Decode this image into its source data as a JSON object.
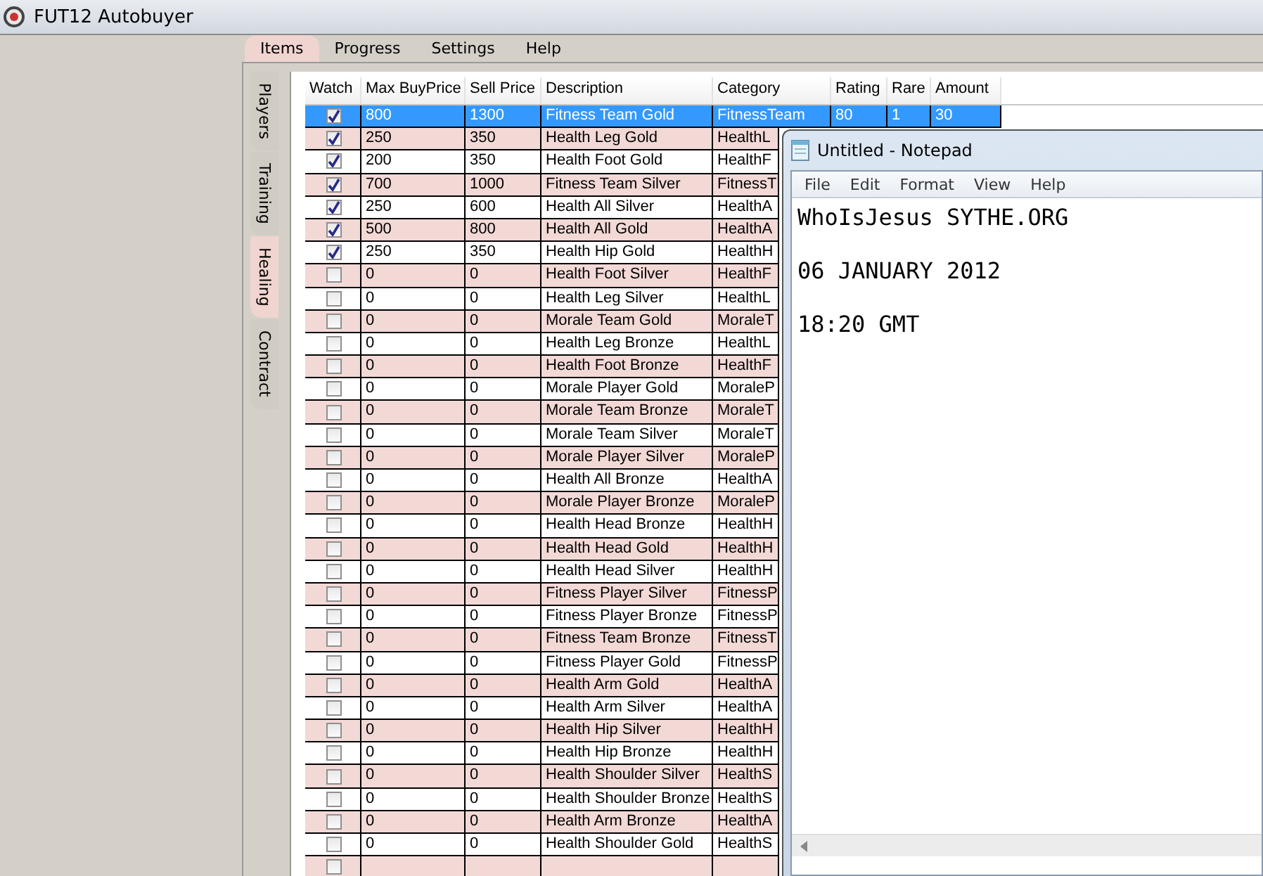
{
  "window": {
    "title": "FUT12 Autobuyer"
  },
  "menu_tabs": [
    {
      "label": "Items",
      "selected": true
    },
    {
      "label": "Progress",
      "selected": false
    },
    {
      "label": "Settings",
      "selected": false
    },
    {
      "label": "Help",
      "selected": false
    }
  ],
  "side_tabs": [
    {
      "label": "Players",
      "selected": false
    },
    {
      "label": "Training",
      "selected": false
    },
    {
      "label": "Healing",
      "selected": true
    },
    {
      "label": "Contract",
      "selected": false
    }
  ],
  "table": {
    "columns": [
      "Watch",
      "Max BuyPrice",
      "Sell Price",
      "Description",
      "Category",
      "Rating",
      "Rare",
      "Amount"
    ],
    "rows": [
      {
        "selected": true,
        "watch": true,
        "max_buy_price": "800",
        "sell_price": "1300",
        "description": "Fitness Team Gold",
        "category": "FitnessTeam",
        "rating": "80",
        "rare": "1",
        "amount": "30"
      },
      {
        "selected": false,
        "watch": true,
        "max_buy_price": "250",
        "sell_price": "350",
        "description": "Health Leg Gold",
        "category": "HealthL"
      },
      {
        "selected": false,
        "watch": true,
        "max_buy_price": "200",
        "sell_price": "350",
        "description": "Health Foot Gold",
        "category": "HealthF"
      },
      {
        "selected": false,
        "watch": true,
        "max_buy_price": "700",
        "sell_price": "1000",
        "description": "Fitness Team Silver",
        "category": "FitnessT"
      },
      {
        "selected": false,
        "watch": true,
        "max_buy_price": "250",
        "sell_price": "600",
        "description": "Health All Silver",
        "category": "HealthA"
      },
      {
        "selected": false,
        "watch": true,
        "max_buy_price": "500",
        "sell_price": "800",
        "description": "Health All Gold",
        "category": "HealthA"
      },
      {
        "selected": false,
        "watch": true,
        "max_buy_price": "250",
        "sell_price": "350",
        "description": "Health Hip Gold",
        "category": "HealthH"
      },
      {
        "selected": false,
        "watch": false,
        "max_buy_price": "0",
        "sell_price": "0",
        "description": "Health Foot Silver",
        "category": "HealthF"
      },
      {
        "selected": false,
        "watch": false,
        "max_buy_price": "0",
        "sell_price": "0",
        "description": "Health Leg Silver",
        "category": "HealthL"
      },
      {
        "selected": false,
        "watch": false,
        "max_buy_price": "0",
        "sell_price": "0",
        "description": "Morale Team Gold",
        "category": "MoraleT"
      },
      {
        "selected": false,
        "watch": false,
        "max_buy_price": "0",
        "sell_price": "0",
        "description": "Health Leg Bronze",
        "category": "HealthL"
      },
      {
        "selected": false,
        "watch": false,
        "max_buy_price": "0",
        "sell_price": "0",
        "description": "Health Foot Bronze",
        "category": "HealthF"
      },
      {
        "selected": false,
        "watch": false,
        "max_buy_price": "0",
        "sell_price": "0",
        "description": "Morale Player Gold",
        "category": "MoraleP"
      },
      {
        "selected": false,
        "watch": false,
        "max_buy_price": "0",
        "sell_price": "0",
        "description": "Morale Team Bronze",
        "category": "MoraleT"
      },
      {
        "selected": false,
        "watch": false,
        "max_buy_price": "0",
        "sell_price": "0",
        "description": "Morale Team Silver",
        "category": "MoraleT"
      },
      {
        "selected": false,
        "watch": false,
        "max_buy_price": "0",
        "sell_price": "0",
        "description": "Morale Player Silver",
        "category": "MoraleP"
      },
      {
        "selected": false,
        "watch": false,
        "max_buy_price": "0",
        "sell_price": "0",
        "description": "Health All Bronze",
        "category": "HealthA"
      },
      {
        "selected": false,
        "watch": false,
        "max_buy_price": "0",
        "sell_price": "0",
        "description": "Morale Player Bronze",
        "category": "MoraleP"
      },
      {
        "selected": false,
        "watch": false,
        "max_buy_price": "0",
        "sell_price": "0",
        "description": "Health Head Bronze",
        "category": "HealthH"
      },
      {
        "selected": false,
        "watch": false,
        "max_buy_price": "0",
        "sell_price": "0",
        "description": "Health Head Gold",
        "category": "HealthH"
      },
      {
        "selected": false,
        "watch": false,
        "max_buy_price": "0",
        "sell_price": "0",
        "description": "Health Head Silver",
        "category": "HealthH"
      },
      {
        "selected": false,
        "watch": false,
        "max_buy_price": "0",
        "sell_price": "0",
        "description": "Fitness Player Silver",
        "category": "FitnessP"
      },
      {
        "selected": false,
        "watch": false,
        "max_buy_price": "0",
        "sell_price": "0",
        "description": "Fitness Player Bronze",
        "category": "FitnessP"
      },
      {
        "selected": false,
        "watch": false,
        "max_buy_price": "0",
        "sell_price": "0",
        "description": "Fitness Team Bronze",
        "category": "FitnessT"
      },
      {
        "selected": false,
        "watch": false,
        "max_buy_price": "0",
        "sell_price": "0",
        "description": "Fitness Player Gold",
        "category": "FitnessP"
      },
      {
        "selected": false,
        "watch": false,
        "max_buy_price": "0",
        "sell_price": "0",
        "description": "Health Arm Gold",
        "category": "HealthA"
      },
      {
        "selected": false,
        "watch": false,
        "max_buy_price": "0",
        "sell_price": "0",
        "description": "Health Arm Silver",
        "category": "HealthA"
      },
      {
        "selected": false,
        "watch": false,
        "max_buy_price": "0",
        "sell_price": "0",
        "description": "Health Hip Silver",
        "category": "HealthH"
      },
      {
        "selected": false,
        "watch": false,
        "max_buy_price": "0",
        "sell_price": "0",
        "description": "Health Hip Bronze",
        "category": "HealthH"
      },
      {
        "selected": false,
        "watch": false,
        "max_buy_price": "0",
        "sell_price": "0",
        "description": "Health Shoulder Silver",
        "category": "HealthS"
      },
      {
        "selected": false,
        "watch": false,
        "max_buy_price": "0",
        "sell_price": "0",
        "description": "Health Shoulder Bronze",
        "category": "HealthS"
      },
      {
        "selected": false,
        "watch": false,
        "max_buy_price": "0",
        "sell_price": "0",
        "description": "Health Arm Bronze",
        "category": "HealthA"
      },
      {
        "selected": false,
        "watch": false,
        "max_buy_price": "0",
        "sell_price": "0",
        "description": "Health Shoulder Gold",
        "category": "HealthS"
      },
      {
        "selected": false,
        "watch": false
      }
    ]
  },
  "notepad": {
    "title": "Untitled - Notepad",
    "menu": [
      "File",
      "Edit",
      "Format",
      "View",
      "Help"
    ],
    "text": "WhoIsJesus SYTHE.ORG\n\n06 JANUARY 2012\n\n18:20 GMT"
  }
}
